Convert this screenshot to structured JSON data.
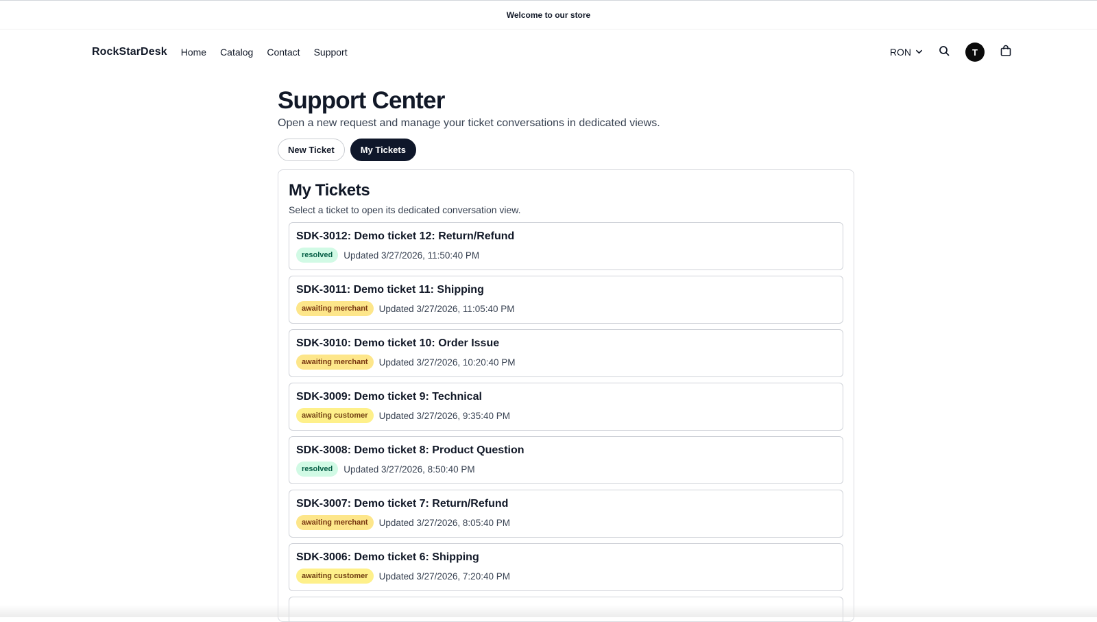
{
  "announcement": "Welcome to our store",
  "header": {
    "brand": "RockStarDesk",
    "nav": [
      "Home",
      "Catalog",
      "Contact",
      "Support"
    ],
    "currency": "RON",
    "avatar_initial": "T"
  },
  "page": {
    "title": "Support Center",
    "subtitle": "Open a new request and manage your ticket conversations in dedicated views.",
    "tabs": {
      "new_ticket": "New Ticket",
      "my_tickets": "My Tickets",
      "active": "my_tickets"
    }
  },
  "panel": {
    "title": "My Tickets",
    "description": "Select a ticket to open its dedicated conversation view.",
    "tickets": [
      {
        "title": "SDK-3012: Demo ticket 12: Return/Refund",
        "status": "resolved",
        "updated": "Updated 3/27/2026, 11:50:40 PM"
      },
      {
        "title": "SDK-3011: Demo ticket 11: Shipping",
        "status": "awaiting merchant",
        "updated": "Updated 3/27/2026, 11:05:40 PM"
      },
      {
        "title": "SDK-3010: Demo ticket 10: Order Issue",
        "status": "awaiting merchant",
        "updated": "Updated 3/27/2026, 10:20:40 PM"
      },
      {
        "title": "SDK-3009: Demo ticket 9: Technical",
        "status": "awaiting customer",
        "updated": "Updated 3/27/2026, 9:35:40 PM"
      },
      {
        "title": "SDK-3008: Demo ticket 8: Product Question",
        "status": "resolved",
        "updated": "Updated 3/27/2026, 8:50:40 PM"
      },
      {
        "title": "SDK-3007: Demo ticket 7: Return/Refund",
        "status": "awaiting merchant",
        "updated": "Updated 3/27/2026, 8:05:40 PM"
      },
      {
        "title": "SDK-3006: Demo ticket 6: Shipping",
        "status": "awaiting customer",
        "updated": "Updated 3/27/2026, 7:20:40 PM"
      }
    ]
  },
  "colors": {
    "primary_dark": "#0f172a",
    "resolved_bg": "#d1fae5",
    "merchant_bg": "#fde68a",
    "customer_bg": "#fef08a"
  },
  "icons": [
    "chevron-down-icon",
    "search-icon",
    "shopping-bag-icon"
  ]
}
